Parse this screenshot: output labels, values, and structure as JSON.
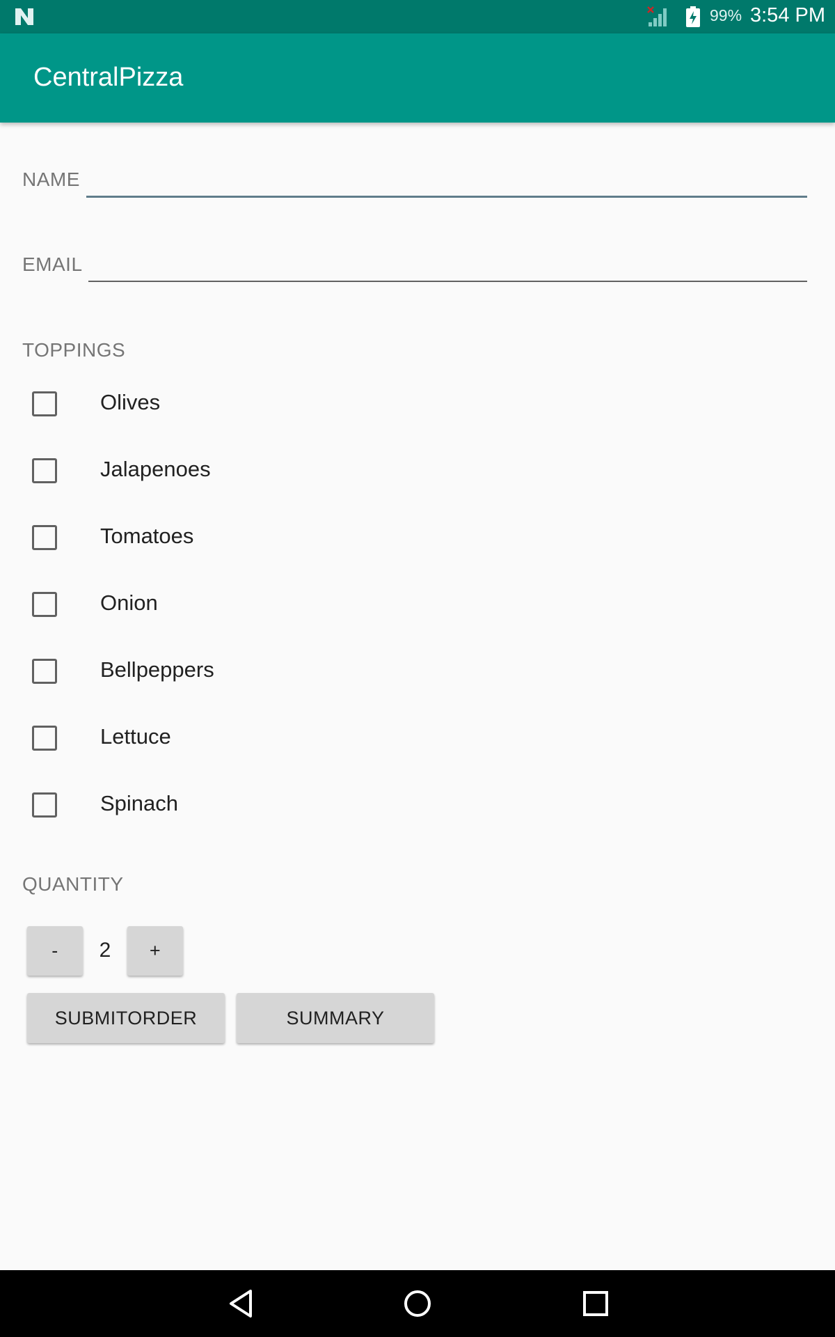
{
  "status_bar": {
    "battery_percent": "99%",
    "time": "3:54 PM",
    "icons": [
      "notification-n-icon",
      "signal-no-service-icon",
      "battery-charging-icon"
    ]
  },
  "app_bar": {
    "title": "CentralPizza"
  },
  "form": {
    "name": {
      "label": "NAME",
      "value": ""
    },
    "email": {
      "label": "EMAIL",
      "value": ""
    }
  },
  "toppings": {
    "label": "TOPPINGS",
    "items": [
      {
        "label": "Olives",
        "checked": false
      },
      {
        "label": "Jalapenoes",
        "checked": false
      },
      {
        "label": "Tomatoes",
        "checked": false
      },
      {
        "label": "Onion",
        "checked": false
      },
      {
        "label": "Bellpeppers",
        "checked": false
      },
      {
        "label": "Lettuce",
        "checked": false
      },
      {
        "label": "Spinach",
        "checked": false
      }
    ]
  },
  "quantity": {
    "label": "QUANTITY",
    "decrement_label": "-",
    "value": "2",
    "increment_label": "+"
  },
  "actions": {
    "submit_label": "SUBMITORDER",
    "summary_label": "SUMMARY"
  },
  "nav_bar": {
    "icons": [
      "back-icon",
      "home-icon",
      "recents-icon"
    ]
  },
  "colors": {
    "status_bar": "#00796b",
    "app_bar": "#009688",
    "background": "#fafafa",
    "button": "#d6d6d6"
  }
}
